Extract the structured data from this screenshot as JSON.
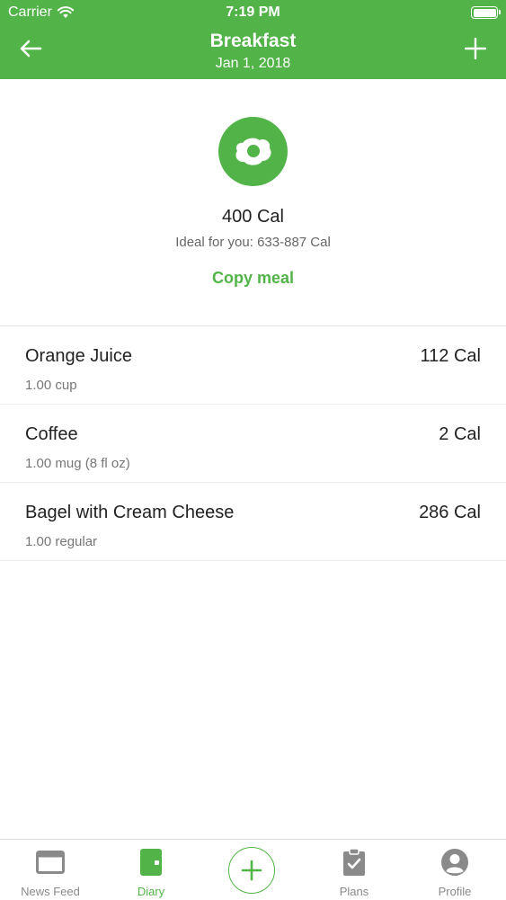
{
  "status_bar": {
    "carrier": "Carrier",
    "time": "7:19 PM"
  },
  "nav": {
    "title": "Breakfast",
    "subtitle": "Jan 1, 2018",
    "back_icon": "arrow-left-icon",
    "add_icon": "plus-icon"
  },
  "summary": {
    "meal_icon": "fried-egg-icon",
    "total_calories": "400 Cal",
    "ideal_range": "Ideal for you: 633-887 Cal",
    "copy_meal_label": "Copy meal"
  },
  "foods": [
    {
      "name": "Orange Juice",
      "calories": "112 Cal",
      "serving": "1.00 cup"
    },
    {
      "name": "Coffee",
      "calories": "2 Cal",
      "serving": "1.00 mug (8 fl oz)"
    },
    {
      "name": "Bagel with Cream Cheese",
      "calories": "286 Cal",
      "serving": "1.00 regular"
    }
  ],
  "tab_bar": {
    "tabs": [
      {
        "label": "News Feed",
        "icon": "news-feed-icon",
        "active": false
      },
      {
        "label": "Diary",
        "icon": "diary-icon",
        "active": true
      },
      {
        "label": "Plans",
        "icon": "clipboard-check-icon",
        "active": false
      },
      {
        "label": "Profile",
        "icon": "profile-icon",
        "active": false
      }
    ],
    "add_icon": "plus-circle-icon"
  },
  "colors": {
    "brand_green": "#52b448",
    "text_primary": "#222222",
    "text_secondary": "#777777",
    "tab_inactive": "#8a8a8a"
  }
}
